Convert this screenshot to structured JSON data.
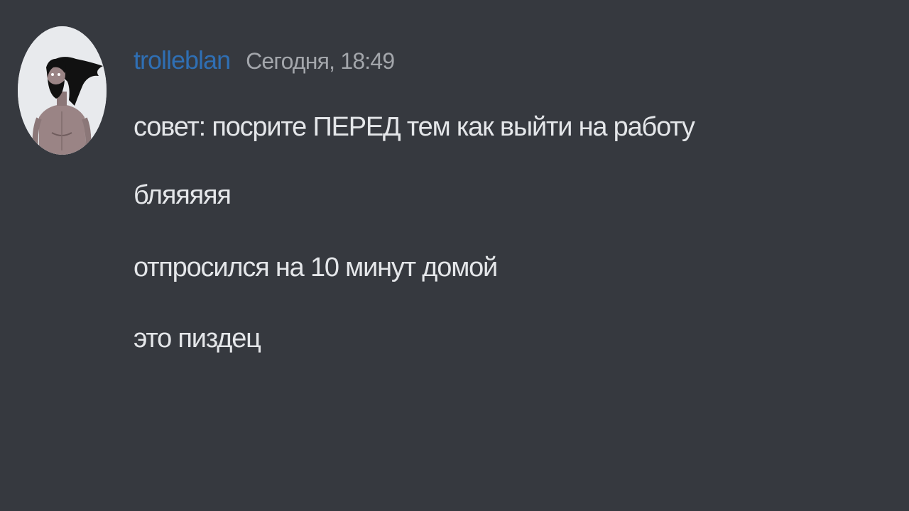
{
  "message": {
    "author": "trolleblan",
    "timestamp": "Сегодня, 18:49",
    "lines": [
      "совет: посрите ПЕРЕД тем как выйти на работу",
      "бляяяяя",
      "отпросился на 10 минут домой",
      "это пиздец"
    ]
  },
  "colors": {
    "background": "#36393f",
    "username": "#2f6fb4",
    "timestamp": "#a3a6ab",
    "message_text": "#e4e6e9"
  },
  "icons": {
    "avatar": "user-avatar"
  }
}
